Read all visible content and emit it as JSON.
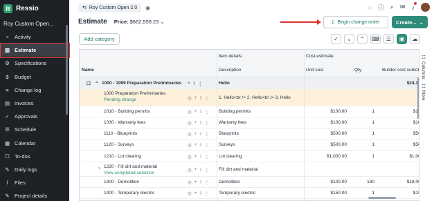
{
  "app": {
    "name": "Ressio",
    "project": "Roy Custom Open..."
  },
  "sidebar": {
    "items": [
      {
        "label": "Activity",
        "icon": "activity-icon",
        "glyph": "⌁"
      },
      {
        "label": "Estimate",
        "icon": "estimate-icon",
        "glyph": "▥",
        "active": true
      },
      {
        "label": "Specifications",
        "icon": "specifications-icon",
        "glyph": "⚙"
      },
      {
        "label": "Budget",
        "icon": "budget-icon",
        "glyph": "$"
      },
      {
        "label": "Change log",
        "icon": "change-log-icon",
        "glyph": "≡"
      },
      {
        "label": "Invoices",
        "icon": "invoices-icon",
        "glyph": "▤"
      },
      {
        "label": "Approvals",
        "icon": "approvals-icon",
        "glyph": "✓"
      },
      {
        "label": "Schedule",
        "icon": "schedule-icon",
        "glyph": "☰"
      },
      {
        "label": "Calendar",
        "icon": "calendar-icon",
        "glyph": "▦"
      },
      {
        "label": "To-dos",
        "icon": "todos-icon",
        "glyph": "☐"
      },
      {
        "label": "Daily logs",
        "icon": "daily-logs-icon",
        "glyph": "✎"
      },
      {
        "label": "Files",
        "icon": "files-icon",
        "glyph": "⌇"
      },
      {
        "label": "Project details",
        "icon": "project-details-icon",
        "glyph": "✎"
      }
    ]
  },
  "topbar": {
    "project_pill": "Roy Custom Open 2.0"
  },
  "header": {
    "title": "Estimate",
    "price_label": "Price:",
    "price_value": "$662,559.23"
  },
  "buttons": {
    "change_order": "Begin change order",
    "create": "Create...",
    "add_category": "Add category"
  },
  "grid": {
    "header": {
      "name": "Name",
      "item_details": "Item details",
      "description": "Description",
      "cost_estimate": "Cost estimate",
      "unit_cost": "Unit cost",
      "qty": "Qty",
      "builder_cost_subtotal": "Builder cost subtotal"
    },
    "rows": [
      {
        "name": "1000 - 1999 Preparation Preliminaries",
        "description": "Hello",
        "unit_cost": "",
        "qty": "",
        "subtotal": "$24,150.",
        "kind": "group"
      },
      {
        "name": "1000 Preparation Preliminaries",
        "sub": "Pending change",
        "description": "1. Hello<br /> 2. Hello<br /> 3. Hello",
        "unit_cost": "",
        "qty": "",
        "subtotal": "",
        "kind": "pending"
      },
      {
        "name": "1010 - Building permits",
        "description": "Building permits",
        "unit_cost": "$100.00",
        "qty": "1",
        "subtotal": "$100.",
        "kind": "item"
      },
      {
        "name": "1030 - Warranty fees",
        "description": "Warranty fees",
        "unit_cost": "$100.00",
        "qty": "1",
        "subtotal": "$100.",
        "kind": "item"
      },
      {
        "name": "1110 - Blueprints",
        "description": "Blueprints",
        "unit_cost": "$500.00",
        "qty": "1",
        "subtotal": "$500.",
        "kind": "item"
      },
      {
        "name": "1120 - Surveys",
        "description": "Surveys",
        "unit_cost": "$500.00",
        "qty": "1",
        "subtotal": "$500.",
        "kind": "item"
      },
      {
        "name": "1210 - Lot clearing",
        "description": "Lot clearing",
        "unit_cost": "$1,000.00",
        "qty": "1",
        "subtotal": "$1,000.",
        "kind": "item"
      },
      {
        "name": "1220 - Fill dirt and material",
        "sub": "View completed selection",
        "description": "Fill dirt and material",
        "unit_cost": "",
        "qty": "",
        "subtotal": "",
        "kind": "selection"
      },
      {
        "name": "1300 - Demolition",
        "description": "Demolition",
        "unit_cost": "$100.00",
        "qty": "180",
        "subtotal": "$18,000.",
        "kind": "item"
      },
      {
        "name": "1400 - Temporary electric",
        "description": "Temporary electric",
        "unit_cost": "$150.00",
        "qty": "1",
        "subtotal": "$150.",
        "kind": "item"
      }
    ]
  },
  "side_tabs": {
    "columns": "Columns",
    "more": "More"
  },
  "colors": {
    "accent": "#2f8c7a",
    "sidebar_bg": "#1e2227",
    "annotation": "#e23b3b"
  }
}
